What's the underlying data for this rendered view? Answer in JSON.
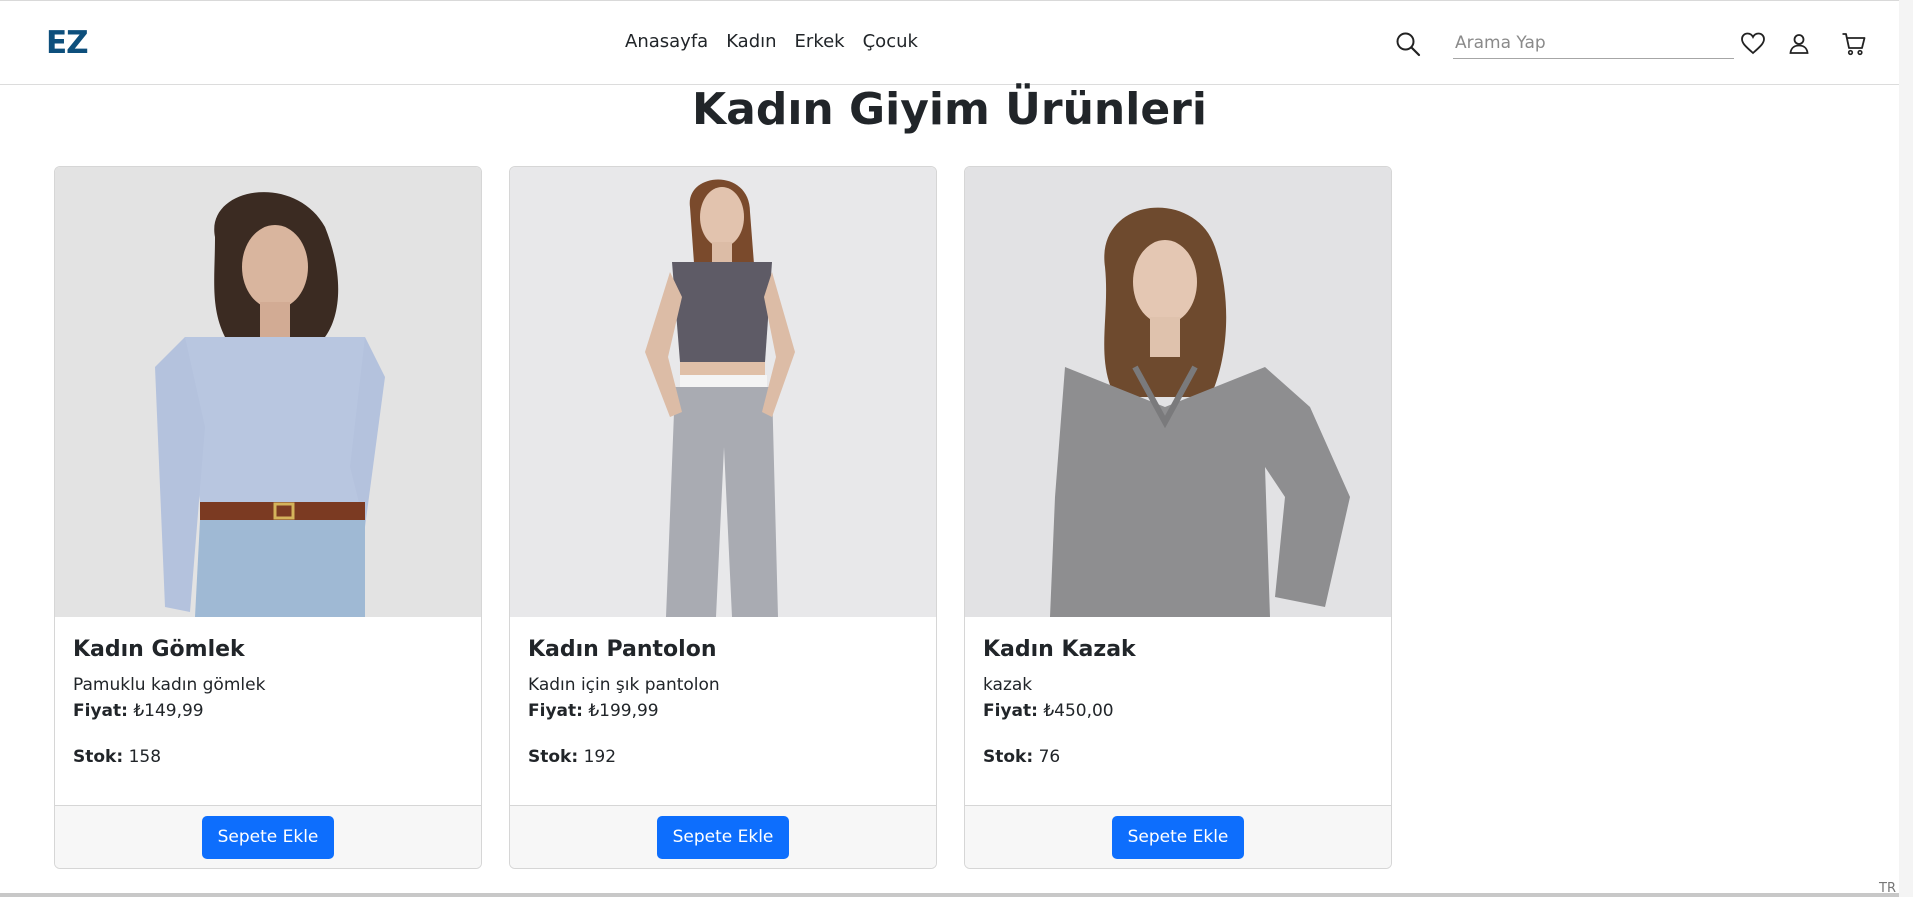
{
  "navbar": {
    "brand": "EZ",
    "links": [
      "Anasayfa",
      "Kadın",
      "Erkek",
      "Çocuk"
    ],
    "search_placeholder": "Arama Yap",
    "icons": [
      "search-icon",
      "heart-icon",
      "user-icon",
      "cart-icon"
    ]
  },
  "page": {
    "title": "Kadın Giyim Ürünleri"
  },
  "products": [
    {
      "name": "Kadın Gömlek",
      "description": "Pamuklu kadın gömlek",
      "price_label": "Fiyat:",
      "price": "₺149,99",
      "stock_label": "Stok:",
      "stock": "158",
      "button": "Sepete Ekle"
    },
    {
      "name": "Kadın Pantolon",
      "description": "Kadın için şık pantolon",
      "price_label": "Fiyat:",
      "price": "₺199,99",
      "stock_label": "Stok:",
      "stock": "192",
      "button": "Sepete Ekle"
    },
    {
      "name": "Kadın Kazak",
      "description": "kazak",
      "price_label": "Fiyat:",
      "price": "₺450,00",
      "stock_label": "Stok:",
      "stock": "76",
      "button": "Sepete Ekle"
    }
  ],
  "footer": {
    "lang": "TR"
  },
  "colors": {
    "brand": "#0d4f7c",
    "primary": "#0d6efd"
  }
}
